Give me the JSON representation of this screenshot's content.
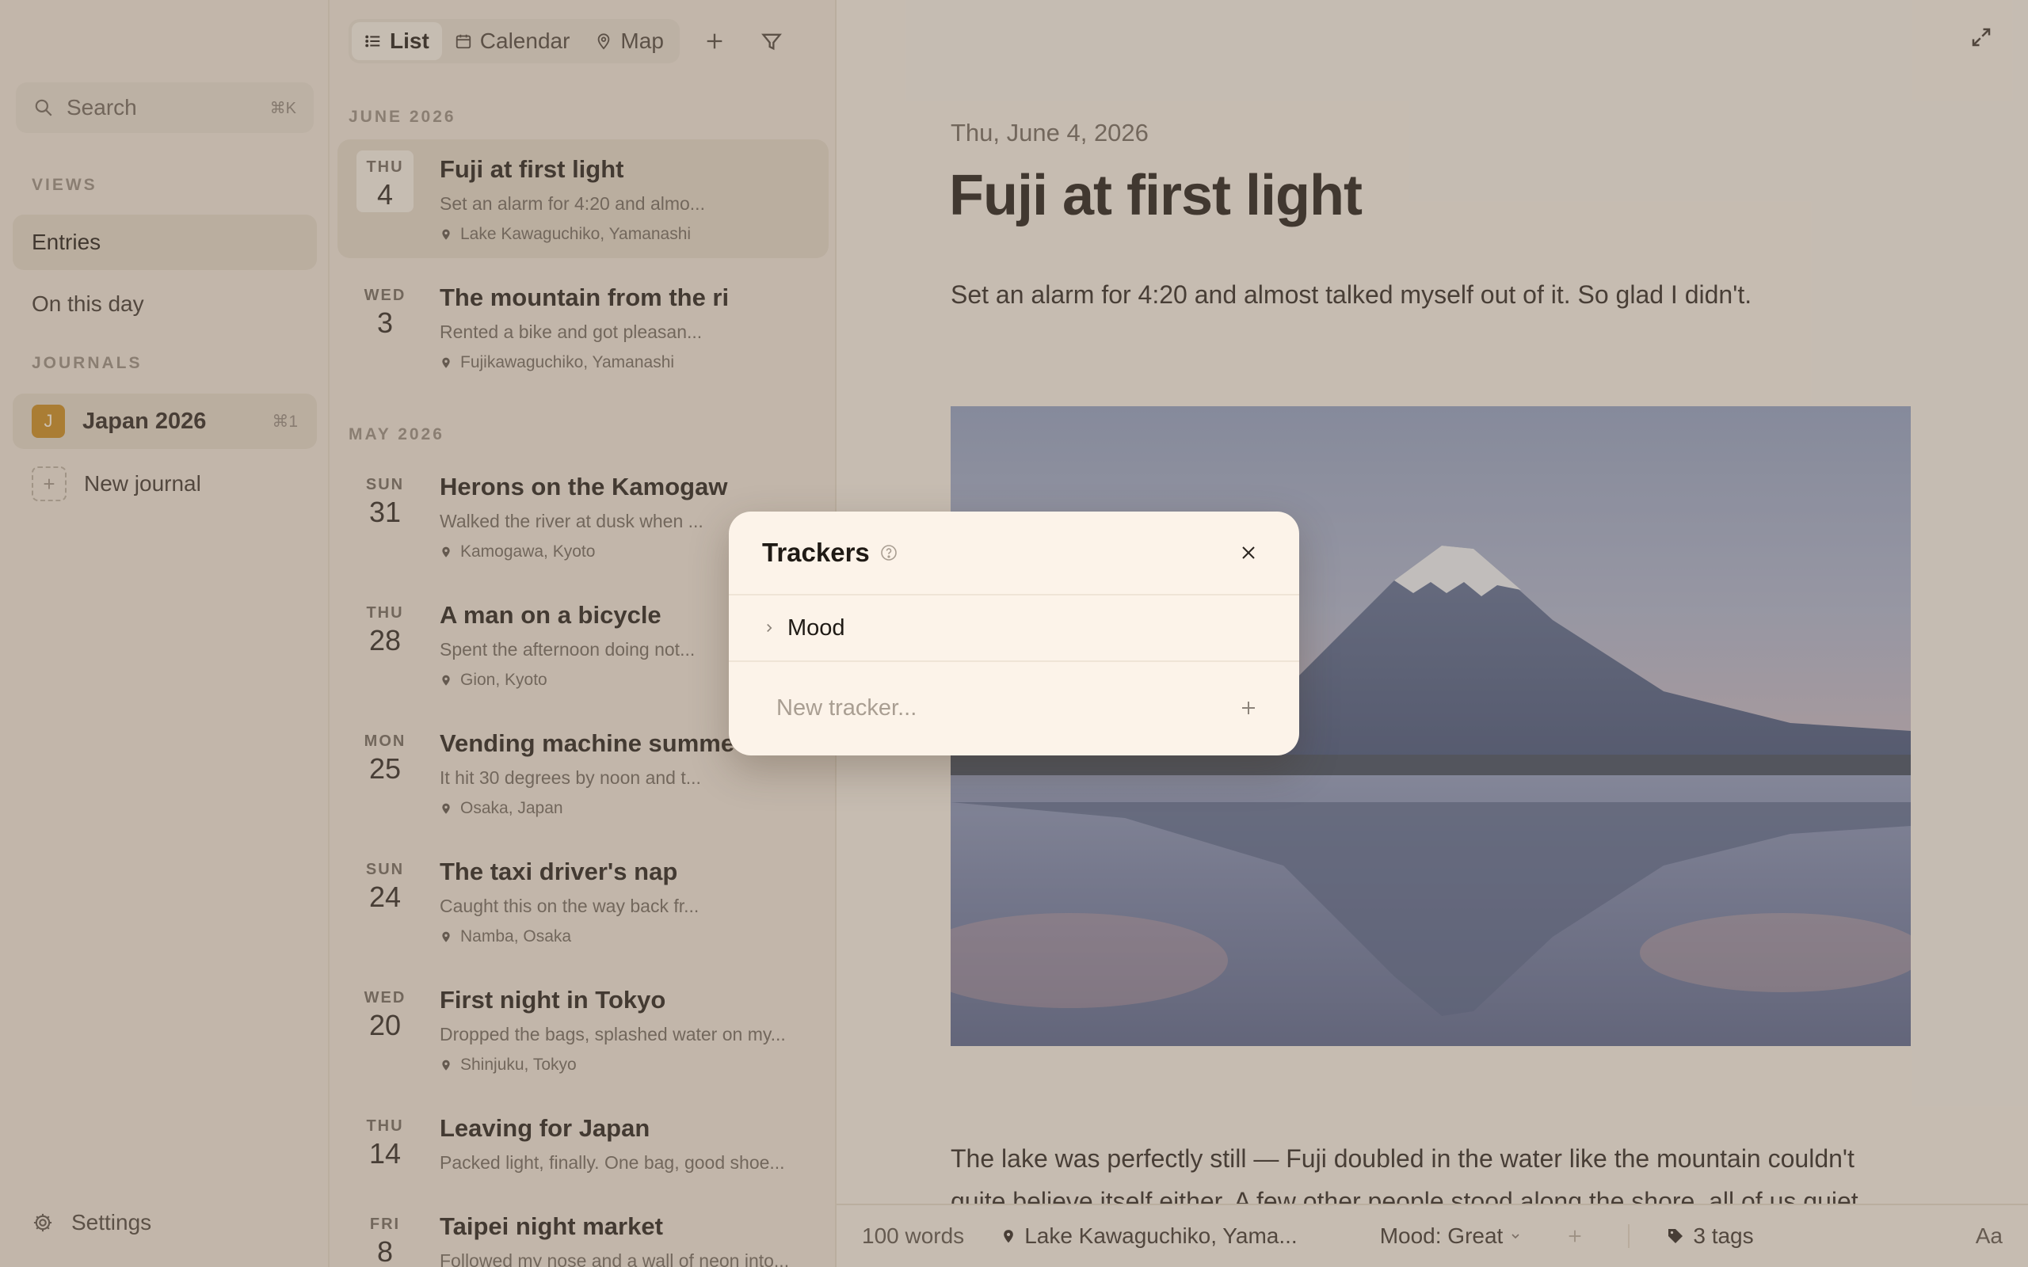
{
  "sidebar": {
    "search_label": "Search",
    "search_shortcut": "⌘K",
    "views_heading": "VIEWS",
    "views": [
      {
        "label": "Entries"
      },
      {
        "label": "On this day"
      }
    ],
    "journals_heading": "JOURNALS",
    "journal": {
      "badge": "J",
      "name": "Japan 2026",
      "shortcut": "⌘1",
      "badge_color": "#c98a1c"
    },
    "new_journal_label": "New journal",
    "settings_label": "Settings"
  },
  "list": {
    "tabs": [
      {
        "label": "List",
        "icon": "list-icon"
      },
      {
        "label": "Calendar",
        "icon": "calendar-icon"
      },
      {
        "label": "Map",
        "icon": "map-pin-icon"
      }
    ],
    "months": [
      "JUNE 2026",
      "MAY 2026"
    ],
    "entries": [
      {
        "dow": "THU",
        "day": "4",
        "title": "Fuji at first light",
        "excerpt": "Set an alarm for 4:20 and almo...",
        "location": "Lake Kawaguchiko, Yamanashi"
      },
      {
        "dow": "WED",
        "day": "3",
        "title": "The mountain from the ri",
        "excerpt": "Rented a bike and got pleasan...",
        "location": "Fujikawaguchiko, Yamanashi"
      },
      {
        "dow": "SUN",
        "day": "31",
        "title": "Herons on the Kamogaw",
        "excerpt": "Walked the river at dusk when ...",
        "location": "Kamogawa, Kyoto"
      },
      {
        "dow": "THU",
        "day": "28",
        "title": "A man on a bicycle",
        "excerpt": "Spent the afternoon doing not...",
        "location": "Gion, Kyoto"
      },
      {
        "dow": "MON",
        "day": "25",
        "title": "Vending machine summe",
        "excerpt": "It hit 30 degrees by noon and t...",
        "location": "Osaka, Japan"
      },
      {
        "dow": "SUN",
        "day": "24",
        "title": "The taxi driver's nap",
        "excerpt": "Caught this on the way back fr...",
        "location": "Namba, Osaka"
      },
      {
        "dow": "WED",
        "day": "20",
        "title": "First night in Tokyo",
        "excerpt": "Dropped the bags, splashed water on my...",
        "location": "Shinjuku, Tokyo"
      },
      {
        "dow": "THU",
        "day": "14",
        "title": "Leaving for Japan",
        "excerpt": "Packed light, finally. One bag, good shoe...",
        "location": ""
      },
      {
        "dow": "FRI",
        "day": "8",
        "title": "Taipei night market",
        "excerpt": "Followed my nose and a wall of neon into...",
        "location": ""
      }
    ]
  },
  "detail": {
    "date": "Thu, June 4, 2026",
    "title": "Fuji at first light",
    "lead": "Set an alarm for 4:20 and almost talked myself out of it. So glad I didn't.",
    "body": "The lake was perfectly still — Fuji doubled in the water like the mountain couldn't quite believe itself either. A few other people stood along the shore, all of us quiet.",
    "status": {
      "words": "100 words",
      "location": "Lake Kawaguchiko, Yama...",
      "mood": "Mood: Great",
      "tags": "3 tags",
      "font_toggle": "Aa"
    }
  },
  "dialog": {
    "title": "Trackers",
    "rows": [
      {
        "label": "Mood"
      }
    ],
    "new_placeholder": "New tracker..."
  }
}
